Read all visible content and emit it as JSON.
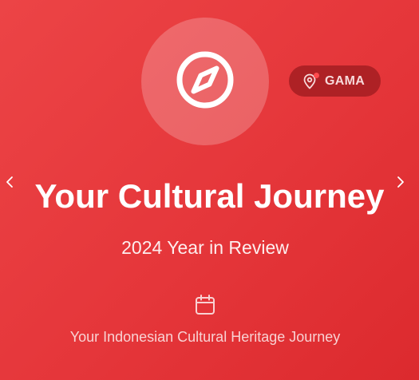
{
  "card": {
    "title": "Your Cultural Journey",
    "subtitle": "2024 Year in Review",
    "caption": "Your Indonesian Cultural Heritage Journey",
    "hero_icon": "compass-icon",
    "calendar_icon": "calendar-icon"
  },
  "badge": {
    "label": "GAMA",
    "icon": "map-pin-icon"
  },
  "navigation": {
    "prev_icon": "chevron-left-icon",
    "next_icon": "chevron-right-icon"
  },
  "colors": {
    "background": "#e5363a",
    "badge_background": "#ae2125",
    "text": "#ffffff"
  }
}
